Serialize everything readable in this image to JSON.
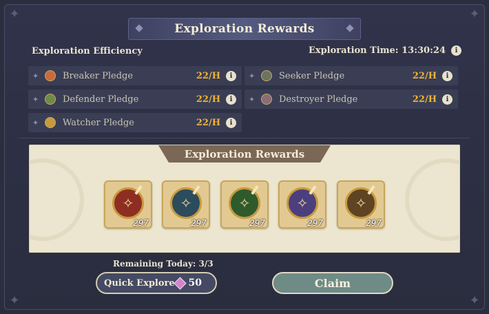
{
  "title": "Exploration Rewards",
  "efficiency_label": "Exploration Efficiency",
  "time_label": "Exploration Time: 13:30:24",
  "info_glyph": "i",
  "pledges": [
    {
      "name": "Breaker Pledge",
      "rate": "22/H",
      "icon_color": "#c96a3a"
    },
    {
      "name": "Seeker Pledge",
      "rate": "22/H",
      "icon_color": "#6a7460"
    },
    {
      "name": "Defender Pledge",
      "rate": "22/H",
      "icon_color": "#6f8a4a"
    },
    {
      "name": "Destroyer Pledge",
      "rate": "22/H",
      "icon_color": "#8a6c78"
    },
    {
      "name": "Watcher Pledge",
      "rate": "22/H",
      "icon_color": "#c79a3f"
    }
  ],
  "rewards_header": "Exploration Rewards",
  "rewards": [
    {
      "icon": "breaker-medal-icon",
      "qty": "297",
      "color": "#8e2e22"
    },
    {
      "icon": "seeker-medal-icon",
      "qty": "297",
      "color": "#2c4b5c"
    },
    {
      "icon": "defender-medal-icon",
      "qty": "297",
      "color": "#2f5a2c"
    },
    {
      "icon": "destroyer-medal-icon",
      "qty": "297",
      "color": "#4b3f7d"
    },
    {
      "icon": "watcher-medal-icon",
      "qty": "297",
      "color": "#5e4422"
    }
  ],
  "remaining_today": "Remaining Today: 3/3",
  "quick_explore": {
    "label": "Quick Explore",
    "cost": "50",
    "cost_icon": "gem-icon"
  },
  "claim_label": "Claim",
  "colors": {
    "accent_rate": "#f0b239",
    "background": "#2b2e3f",
    "panel": "#ece5cf"
  }
}
